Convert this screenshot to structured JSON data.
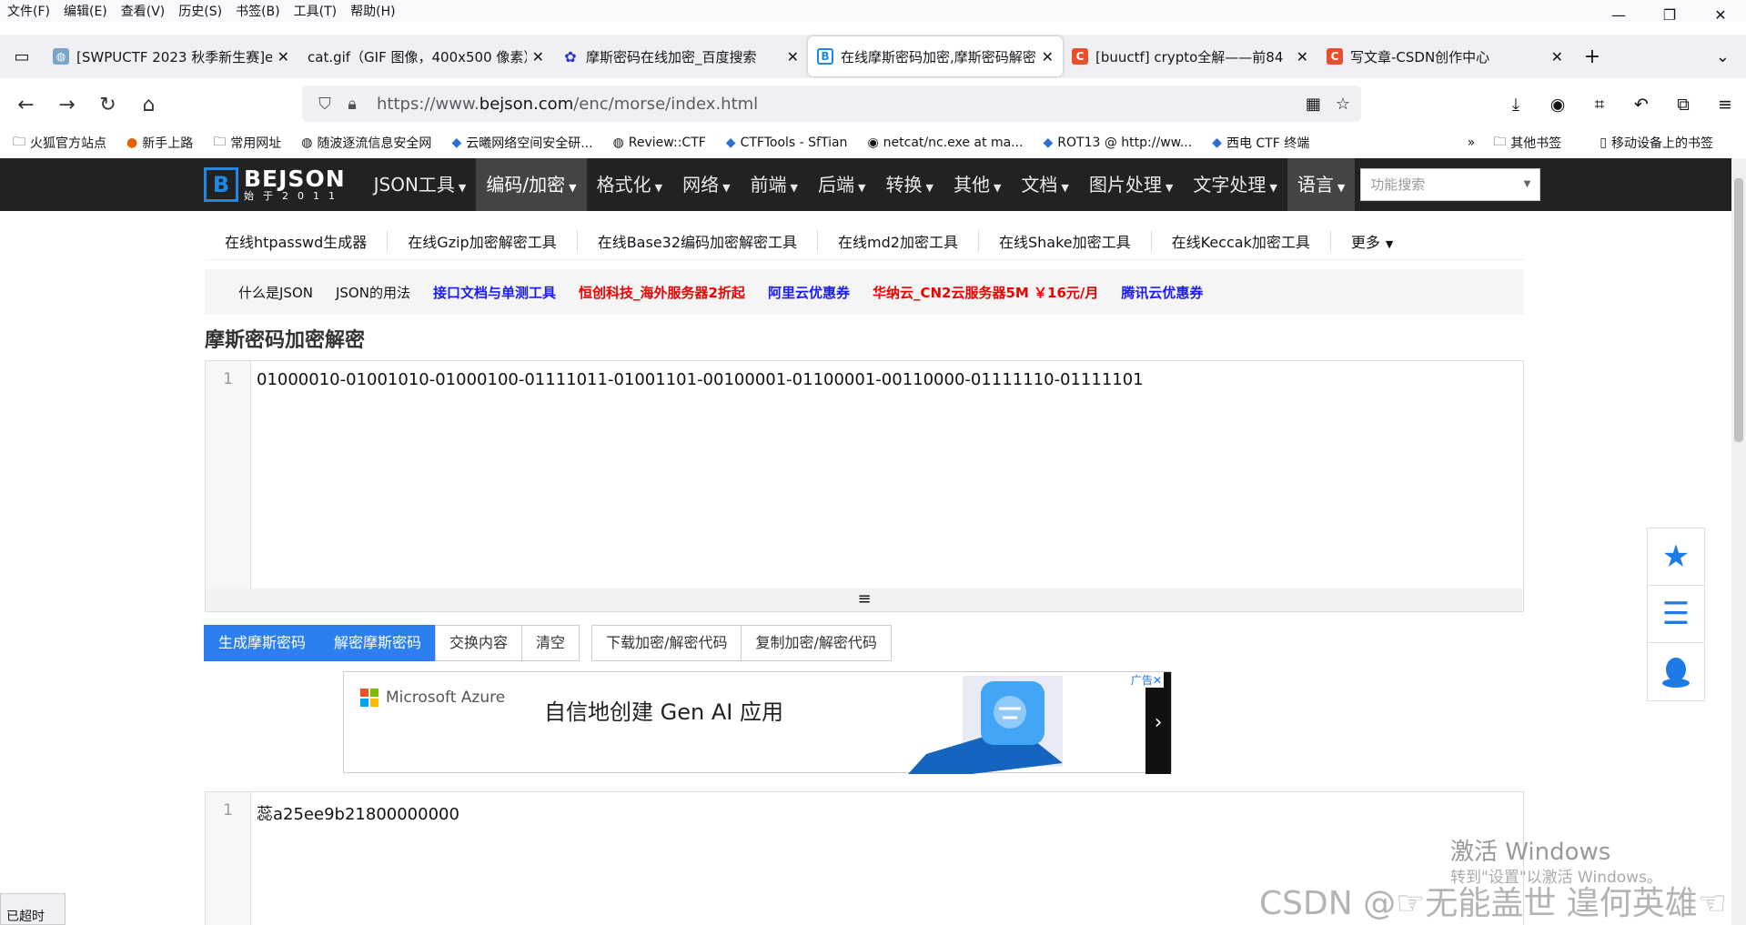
{
  "menubar": {
    "items": [
      "文件(F)",
      "编辑(E)",
      "查看(V)",
      "历史(S)",
      "书签(B)",
      "工具(T)",
      "帮助(H)"
    ]
  },
  "window_controls": {
    "minimize": "—",
    "restore": "❐",
    "close": "✕"
  },
  "tabs": [
    {
      "title": "[SWPUCTF 2023 秋季新生赛]e",
      "icon_color": "#7aa5c9",
      "icon": "globe"
    },
    {
      "title": "cat.gif（GIF 图像，400x500 像素）",
      "icon_color": "",
      "icon": ""
    },
    {
      "title": "摩斯密码在线加密_百度搜索",
      "icon_color": "#2932e1",
      "icon": "baidu-paw"
    },
    {
      "title": "在线摩斯密码加密,摩斯密码解密",
      "icon_color": "#1e88e5",
      "icon": "bejson-b"
    },
    {
      "title": "[buuctf] crypto全解——前84",
      "icon_color": "#e94e2d",
      "icon": "csdn-c"
    },
    {
      "title": "写文章-CSDN创作中心",
      "icon_color": "#e94e2d",
      "icon": "csdn-c"
    }
  ],
  "url": {
    "prefix": "https://www.",
    "domain": "bejson.com",
    "path": "/enc/morse/index.html"
  },
  "bookmarks": {
    "items": [
      {
        "label": "火狐官方站点",
        "icon": "folder-icon"
      },
      {
        "label": "新手上路",
        "icon": "firefox-icon"
      },
      {
        "label": "常用网址",
        "icon": "folder-icon"
      },
      {
        "label": "随波逐流信息安全网",
        "icon": "globe-icon"
      },
      {
        "label": "云曦网络空间安全研...",
        "icon": "site-icon"
      },
      {
        "label": "Review::CTF",
        "icon": "globe-icon"
      },
      {
        "label": "CTFTools - SfTian",
        "icon": "site-icon"
      },
      {
        "label": "netcat/nc.exe at ma...",
        "icon": "github-icon"
      },
      {
        "label": "ROT13 @ http://ww...",
        "icon": "site-icon"
      },
      {
        "label": "西电 CTF 终端",
        "icon": "site-icon"
      }
    ],
    "other": "其他书签",
    "mobile": "移动设备上的书签"
  },
  "site": {
    "logo_title": "BEJSON",
    "logo_sub": "始于2011",
    "nav": [
      "JSON工具",
      "编码/加密",
      "格式化",
      "网络",
      "前端",
      "后端",
      "转换",
      "其他",
      "文档",
      "图片处理",
      "文字处理",
      "语言"
    ],
    "search_placeholder": "功能搜索",
    "sublinks": [
      "在线htpasswd生成器",
      "在线Gzip加密解密工具",
      "在线Base32编码加密解密工具",
      "在线md2加密工具",
      "在线Shake加密工具",
      "在线Keccak加密工具",
      "更多"
    ],
    "notice": [
      {
        "text": "什么是JSON",
        "style": "plain"
      },
      {
        "text": "JSON的用法",
        "style": "plain"
      },
      {
        "text": "接口文档与单测工具",
        "style": "blue"
      },
      {
        "text": "恒创科技_海外服务器2折起",
        "style": "red"
      },
      {
        "text": "阿里云优惠券",
        "style": "blue"
      },
      {
        "text": "华纳云_CN2云服务器5M ￥16元/月",
        "style": "red"
      },
      {
        "text": "腾讯云优惠券",
        "style": "blue"
      }
    ],
    "heading": "摩斯密码加密解密",
    "input_line": "1",
    "input_text": "01000010-01001010-01000100-01111011-01001101-00100001-01100001-00110000-01111110-01111101",
    "buttons_group1": [
      "生成摩斯密码",
      "解密摩斯密码",
      "交换内容",
      "清空"
    ],
    "buttons_group2": [
      "下载加密/解密代码",
      "复制加密/解密代码"
    ],
    "ad": {
      "brand": "Microsoft Azure",
      "title": "自信地创建 Gen AI 应用",
      "label": "广告",
      "close": "✕",
      "arrow": "›"
    },
    "output_line": "1",
    "output_text": "蕊a25ee9b21800000000"
  },
  "watermark": {
    "line1": "激活 Windows",
    "line2": "转到\"设置\"以激活 Windows。",
    "csdn": "CSDN @☞无能盖世 遑何英雄☜"
  },
  "status": "已超时",
  "colors": {
    "accent": "#2b7ff0",
    "nav_bg": "#222222",
    "logo_blue": "#1e88e5"
  }
}
